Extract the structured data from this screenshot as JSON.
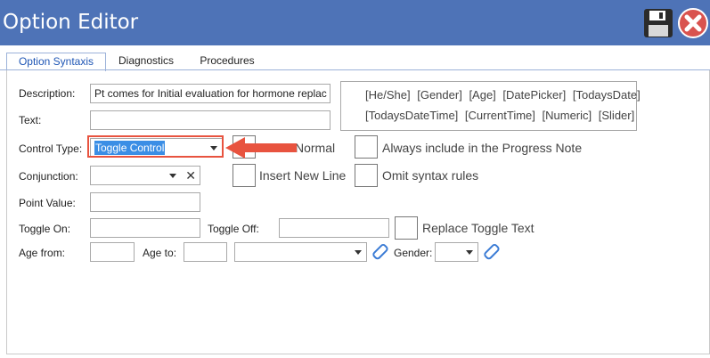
{
  "window": {
    "title": "Option Editor"
  },
  "tabs": [
    {
      "label": "Option Syntaxis"
    },
    {
      "label": "Diagnostics"
    },
    {
      "label": "Procedures"
    }
  ],
  "form": {
    "description_label": "Description:",
    "description_value": "Pt comes for Initial evaluation for hormone replac",
    "text_label": "Text:",
    "text_value": "",
    "control_type_label": "Control Type:",
    "control_type_value": "Toggle Control",
    "conjunction_label": "Conjunction:",
    "conjunction_value": "",
    "point_value_label": "Point Value:",
    "point_value": "",
    "toggle_on_label": "Toggle On:",
    "toggle_on_value": "",
    "toggle_off_label": "Toggle Off:",
    "toggle_off_value": "",
    "age_from_label": "Age from:",
    "age_to_label": "Age to:",
    "gender_label": "Gender:"
  },
  "checkboxes": {
    "normal_label_partial": "Normal",
    "insert_new_line": "Insert New Line",
    "always_include": "Always include in the Progress Note",
    "omit_syntax": "Omit syntax rules",
    "replace_toggle": "Replace Toggle Text"
  },
  "tags": {
    "line1": [
      "[He/She]",
      "[Gender]",
      "[Age]",
      "[DatePicker]",
      "[TodaysDate]"
    ],
    "line2": [
      "[TodaysDateTime]",
      "[CurrentTime]",
      "[Numeric]",
      "[Slider]"
    ]
  },
  "colors": {
    "titlebar": "#4e73b7",
    "annotation": "#e8533f",
    "selection": "#3b8ee5"
  }
}
